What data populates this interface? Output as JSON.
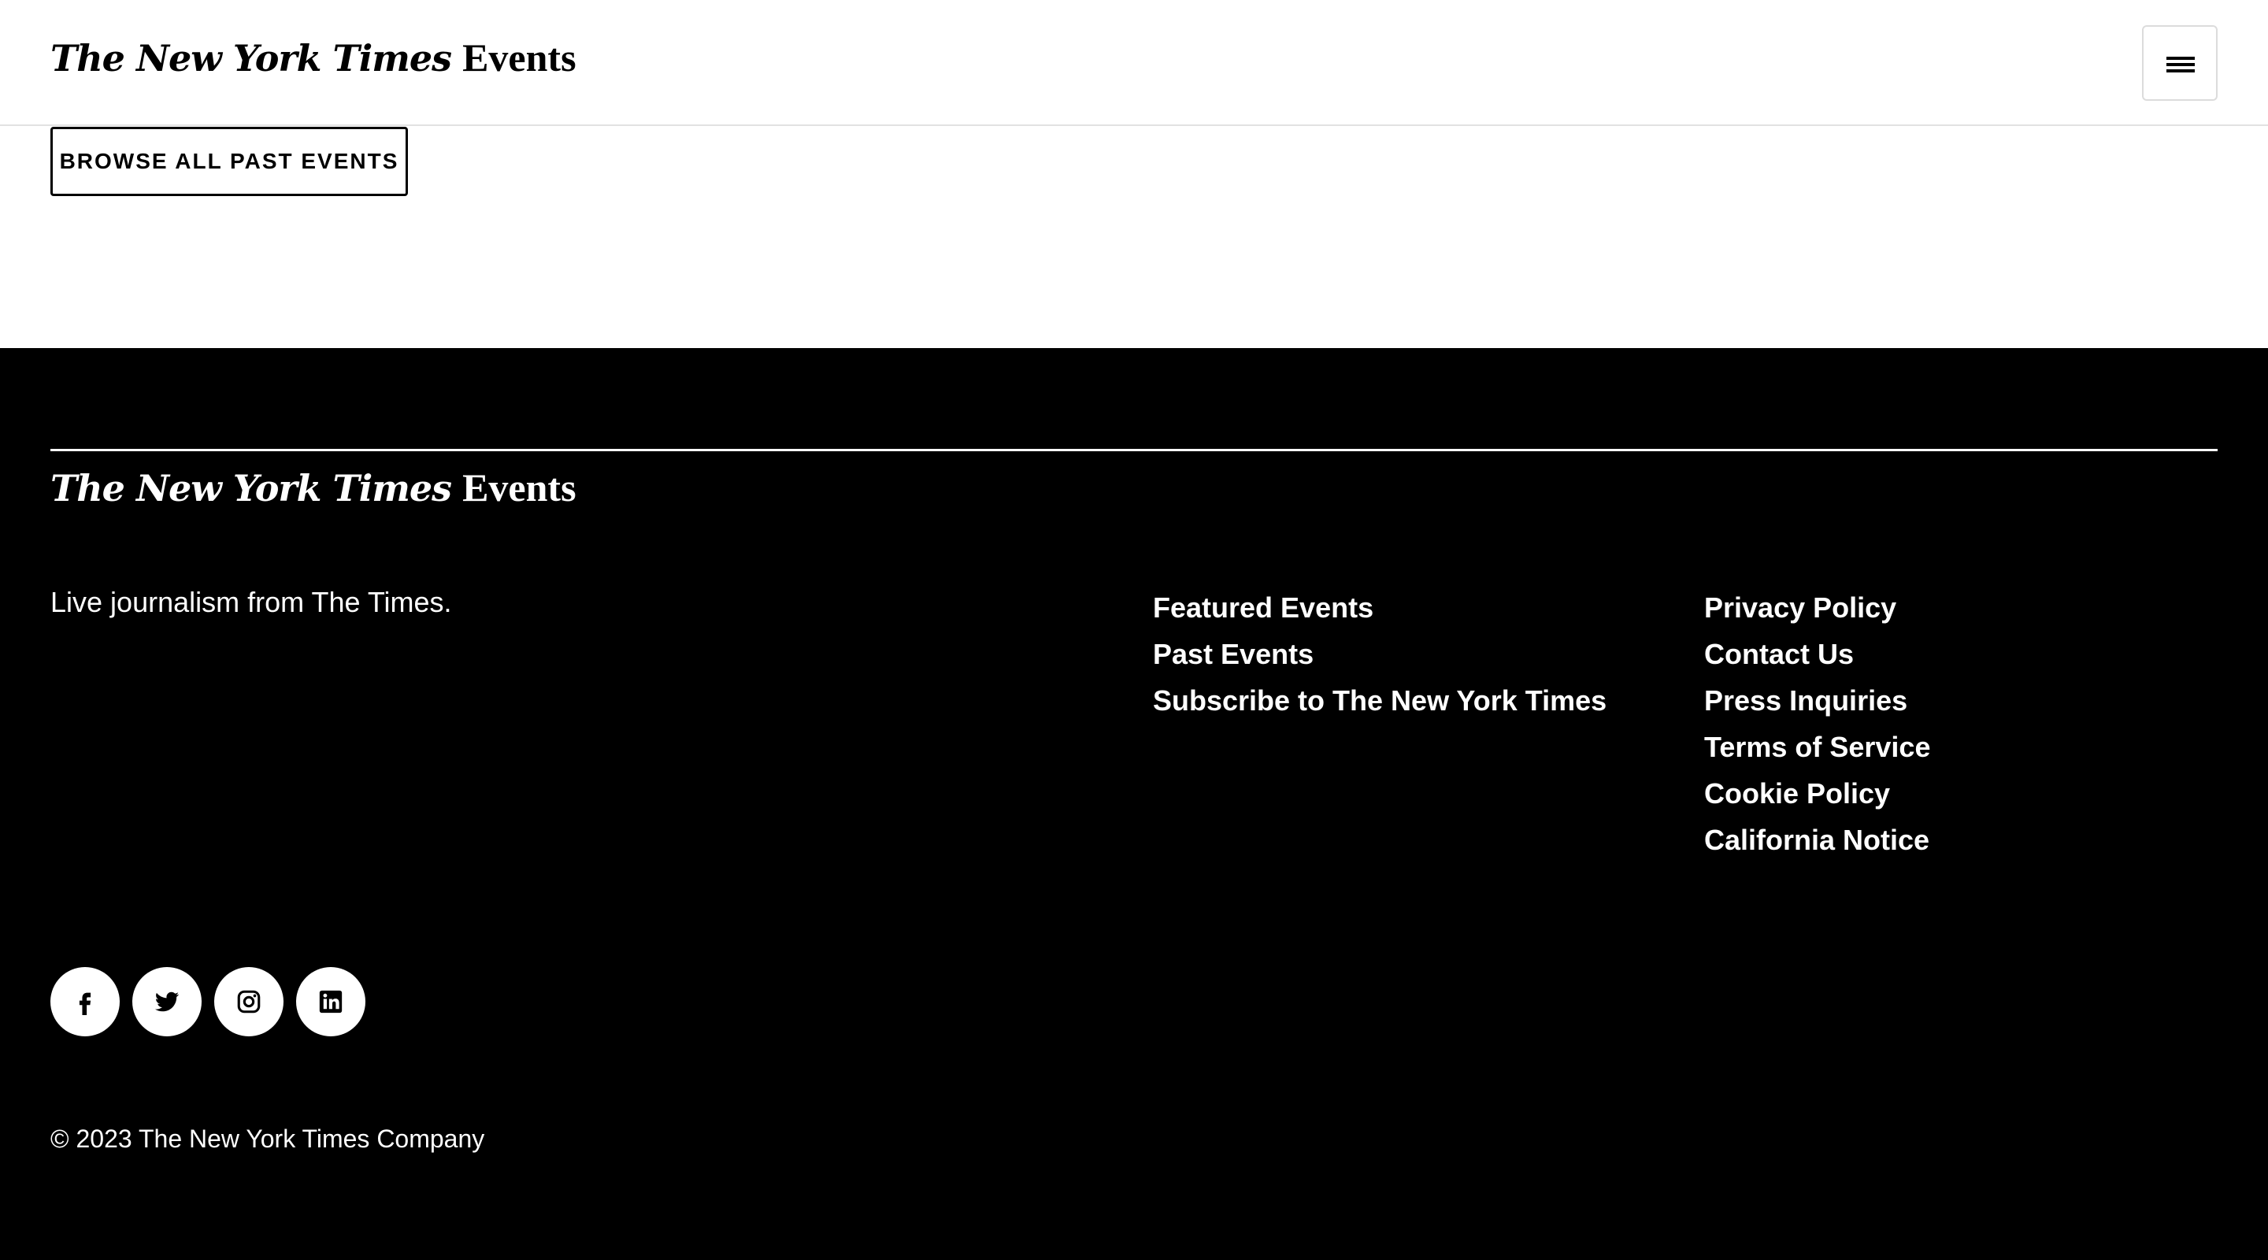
{
  "header": {
    "logo_brand": "The New York Times",
    "logo_suffix": "Events",
    "menu_label": "Menu"
  },
  "main": {
    "browse_button": "BROWSE ALL PAST EVENTS"
  },
  "footer": {
    "logo_brand": "The New York Times",
    "logo_suffix": "Events",
    "tagline": "Live journalism from The Times.",
    "links_col1": [
      "Featured Events",
      "Past Events",
      "Subscribe to The New York Times"
    ],
    "links_col2": [
      "Privacy Policy",
      "Contact Us",
      "Press Inquiries",
      "Terms of Service",
      "Cookie Policy",
      "California Notice"
    ],
    "social_icons": [
      "facebook-icon",
      "twitter-icon",
      "instagram-icon",
      "linkedin-icon"
    ],
    "copyright": "© 2023 The New York Times Company"
  },
  "colors": {
    "header_bg": "#ffffff",
    "footer_bg": "#000000",
    "text_dark": "#000000",
    "text_light": "#ffffff"
  }
}
